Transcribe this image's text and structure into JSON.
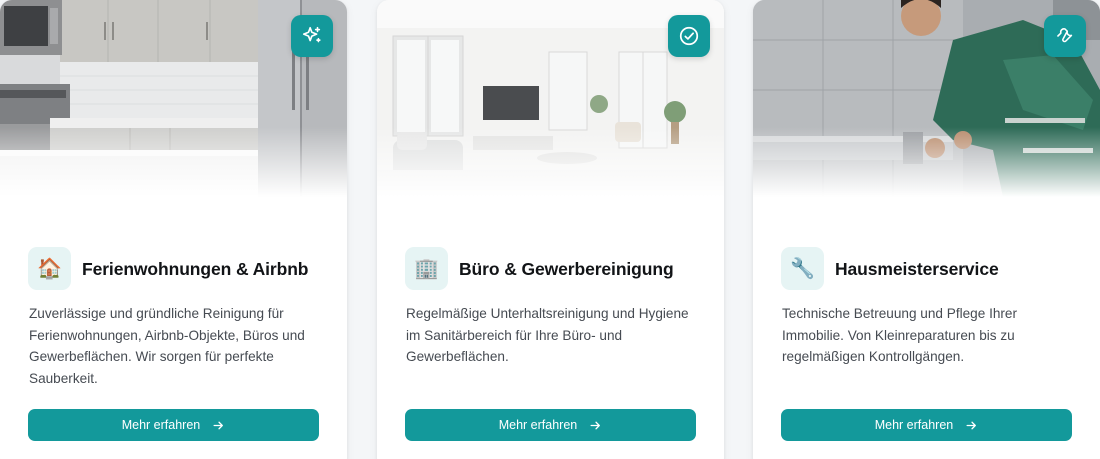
{
  "cards": [
    {
      "title": "Ferienwohnungen & Airbnb",
      "icon": "house-icon",
      "icon_glyph": "🏠",
      "badge_icon": "sparkles-icon",
      "description": "Zuverlässige und gründliche Reinigung für Ferienwohnungen, Airbnb-Objekte, Büros und Gewerbeflächen. Wir sorgen für perfekte Sauberkeit.",
      "button_label": "Mehr erfahren"
    },
    {
      "title": "Büro & Gewerbereinigung",
      "icon": "office-building-icon",
      "icon_glyph": "🏢",
      "badge_icon": "check-circle-icon",
      "description": "Regelmäßige Unterhaltsreinigung und Hygiene im Sanitärbereich für Ihre Büro- und Gewerbeflächen.",
      "button_label": "Mehr erfahren"
    },
    {
      "title": "Hausmeisterservice",
      "icon": "wrench-icon",
      "icon_glyph": "🔧",
      "badge_icon": "wrench-badge-icon",
      "description": "Technische Betreuung und Pflege Ihrer Immobilie. Von Kleinreparaturen bis zu regelmäßigen Kontrollgängen.",
      "button_label": "Mehr erfahren"
    }
  ],
  "colors": {
    "accent": "#13999b",
    "icon_bg": "#e6f4f4",
    "title": "#121417",
    "text": "#464b52",
    "page_bg": "#f4f6f8"
  }
}
